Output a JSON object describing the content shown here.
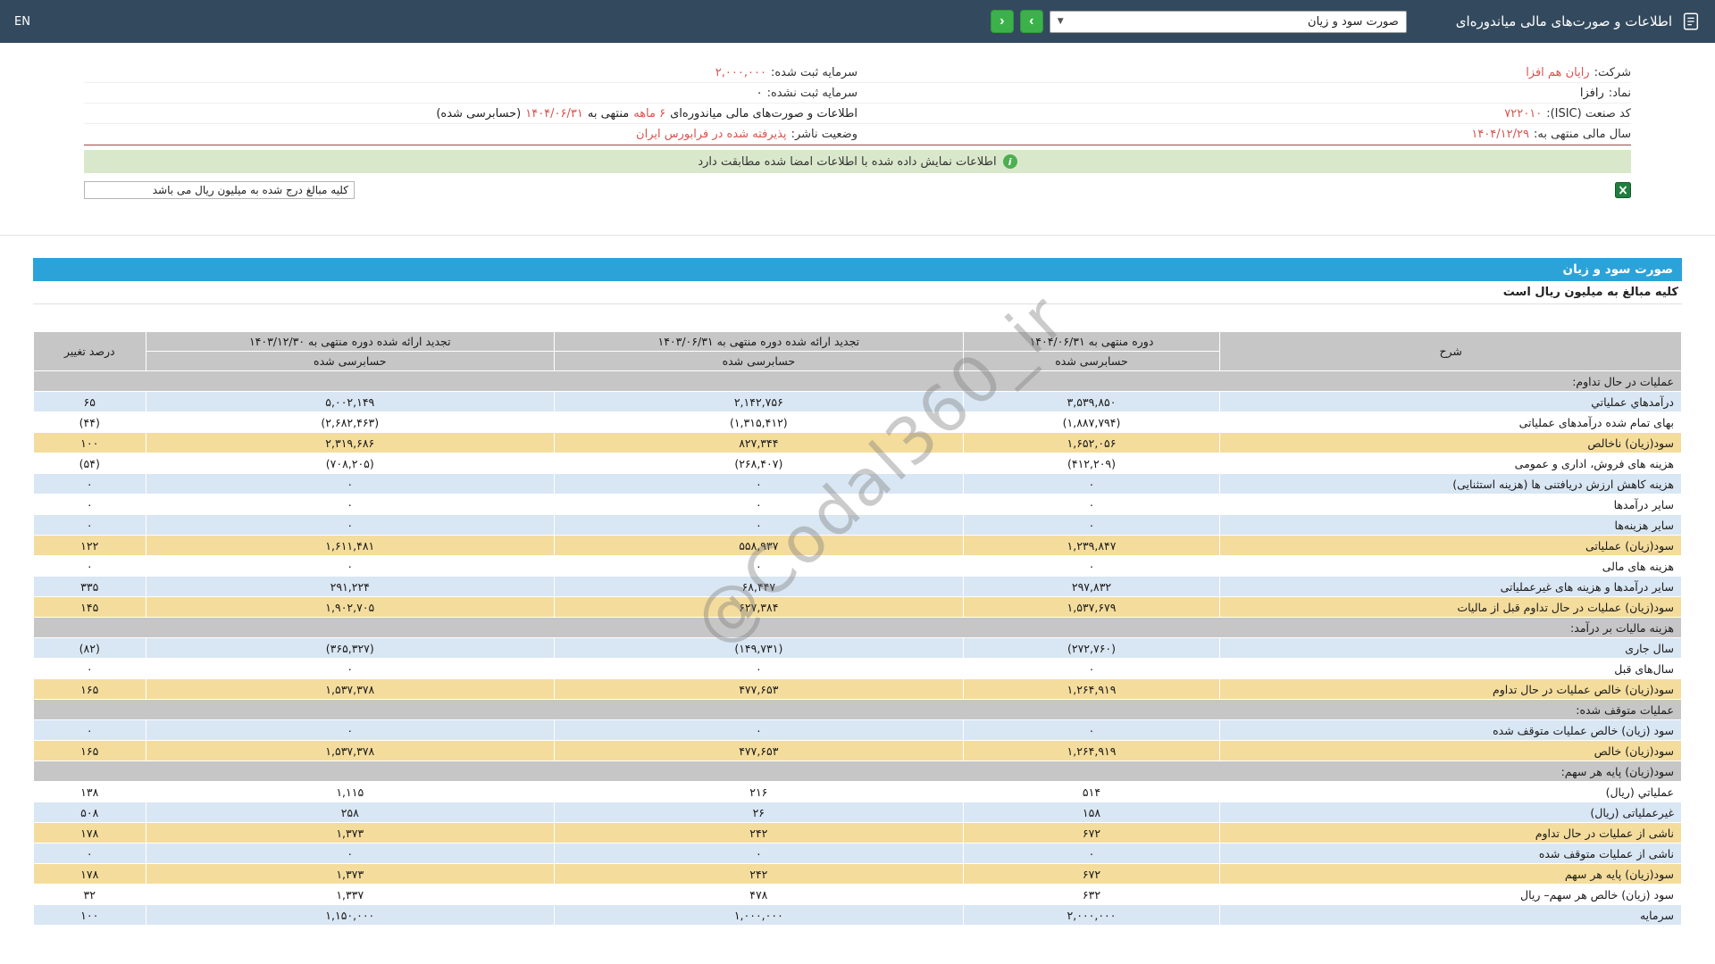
{
  "colors": {
    "navbar": "#334a5e",
    "accent_blue": "#2ba3d9",
    "row_blue": "#d9e6f3",
    "row_highlight_tan": "#f4dc9c",
    "section_gray": "#c6c6c6",
    "negative_red": "#e93323",
    "link_red": "#d9534f",
    "success_green": "#4caf50",
    "button_green": "#3cb14a"
  },
  "navbar": {
    "title": "اطلاعات و صورت‌های مالی میاندوره‌ای",
    "statement_select_value": "صورت سود و زیان",
    "btn_next": "›",
    "btn_prev": "‹",
    "language": "EN"
  },
  "company": {
    "right": [
      {
        "label": "شرکت:",
        "value": "رایان هم افزا"
      },
      {
        "label": "نماد:",
        "value": "رافزا"
      },
      {
        "label": "کد صنعت (ISIC):",
        "value": "۷۲۲۰۱۰"
      },
      {
        "label": "سال مالی منتهی به:",
        "value": "۱۴۰۴/۱۲/۲۹"
      }
    ],
    "left": [
      {
        "label": "سرمایه ثبت شده:",
        "value": "۲,۰۰۰,۰۰۰"
      },
      {
        "label": "سرمایه ثبت نشده:",
        "value": "۰"
      },
      {
        "label": "وضعیت ناشر:",
        "value": "پذیرفته شده در فرابورس ایران"
      }
    ],
    "period": {
      "p1": "اطلاعات و صورت‌های مالی میاندوره‌ای",
      "p2": "۶ ماهه",
      "p3": "منتهی به",
      "p4": "۱۴۰۴/۰۶/۳۱",
      "p5": "(حسابرسی شده)"
    }
  },
  "alert": {
    "icon_glyph": "i",
    "message": "اطلاعات نمایش داده شده با اطلاعات امضا شده مطابقت دارد"
  },
  "units_note_top": "کلیه مبالغ درج شده به میلیون ریال می باشد",
  "statement": {
    "title": "صورت سود و زیان",
    "units_note": "کلیه مبالغ به میلیون ریال است",
    "watermark": "@Codal360_ir"
  },
  "table": {
    "headers": {
      "desc": "شرح",
      "col1": "دوره منتهی به ۱۴۰۴/۰۶/۳۱",
      "col2": "تجدید ارائه شده دوره منتهی به ۱۴۰۳/۰۶/۳۱",
      "col3": "تجدید ارائه شده دوره منتهی به ۱۴۰۳/۱۲/۳۰",
      "pct": "درصد تغییر",
      "audited": "حسابرسی شده"
    },
    "rows": [
      {
        "type": "section",
        "label": "عملیات در حال تداوم:"
      },
      {
        "type": "data",
        "bg": "blue",
        "label": "درآمدهاي عملياتي",
        "v1": "۳,۵۳۹,۸۵۰",
        "v2": "۲,۱۴۲,۷۵۶",
        "v3": "۵,۰۰۲,۱۴۹",
        "pct": "۶۵"
      },
      {
        "type": "data",
        "bg": "white",
        "label": "بهای تمام شده درآمدهای عملیاتی",
        "v1": "(۱,۸۸۷,۷۹۴)",
        "v2": "(۱,۳۱۵,۴۱۲)",
        "v3": "(۲,۶۸۲,۴۶۳)",
        "pct": "(۴۴)"
      },
      {
        "type": "data",
        "bg": "tan",
        "label": "سود(زیان) ناخالص",
        "v1": "۱,۶۵۲,۰۵۶",
        "v2": "۸۲۷,۳۴۴",
        "v3": "۲,۳۱۹,۶۸۶",
        "pct": "۱۰۰"
      },
      {
        "type": "data",
        "bg": "white",
        "label": "هزینه های فروش، اداری و عمومی",
        "v1": "(۴۱۲,۲۰۹)",
        "v2": "(۲۶۸,۴۰۷)",
        "v3": "(۷۰۸,۲۰۵)",
        "pct": "(۵۴)"
      },
      {
        "type": "data",
        "bg": "blue",
        "label": "هزینه کاهش ارزش دریافتنی ها (هزینه استثنایی)",
        "v1": "۰",
        "v2": "۰",
        "v3": "۰",
        "pct": "۰"
      },
      {
        "type": "data",
        "bg": "white",
        "label": "سایر درآمدها",
        "v1": "۰",
        "v2": "۰",
        "v3": "۰",
        "pct": "۰"
      },
      {
        "type": "data",
        "bg": "blue",
        "label": "سایر هزینه‌ها",
        "v1": "۰",
        "v2": "۰",
        "v3": "۰",
        "pct": "۰"
      },
      {
        "type": "data",
        "bg": "tan",
        "label": "سود(زیان) عملیاتی",
        "v1": "۱,۲۳۹,۸۴۷",
        "v2": "۵۵۸,۹۳۷",
        "v3": "۱,۶۱۱,۴۸۱",
        "pct": "۱۲۲"
      },
      {
        "type": "data",
        "bg": "white",
        "label": "هزینه های مالی",
        "v1": "۰",
        "v2": "۰",
        "v3": "۰",
        "pct": "۰"
      },
      {
        "type": "data",
        "bg": "blue",
        "label": "سایر درآمدها و هزینه های غیرعملیاتی",
        "v1": "۲۹۷,۸۳۲",
        "v2": "۶۸,۴۴۷",
        "v3": "۲۹۱,۲۲۴",
        "pct": "۳۳۵"
      },
      {
        "type": "data",
        "bg": "tan",
        "label": "سود(زیان) عملیات در حال تداوم قبل از مالیات",
        "v1": "۱,۵۳۷,۶۷۹",
        "v2": "۶۲۷,۳۸۴",
        "v3": "۱,۹۰۲,۷۰۵",
        "pct": "۱۴۵"
      },
      {
        "type": "section",
        "label": "هزینه مالیات بر درآمد:"
      },
      {
        "type": "data",
        "bg": "blue",
        "label": "سال جاری",
        "v1": "(۲۷۲,۷۶۰)",
        "v2": "(۱۴۹,۷۳۱)",
        "v3": "(۳۶۵,۳۲۷)",
        "pct": "(۸۲)"
      },
      {
        "type": "data",
        "bg": "white",
        "label": "سال‌های قبل",
        "v1": "۰",
        "v2": "۰",
        "v3": "۰",
        "pct": "۰"
      },
      {
        "type": "data",
        "bg": "tan",
        "label": "سود(زیان) خالص عملیات در حال تداوم",
        "v1": "۱,۲۶۴,۹۱۹",
        "v2": "۴۷۷,۶۵۳",
        "v3": "۱,۵۳۷,۳۷۸",
        "pct": "۱۶۵"
      },
      {
        "type": "section",
        "label": "عملیات متوقف شده:"
      },
      {
        "type": "data",
        "bg": "blue",
        "label": "سود (زیان) خالص عملیات متوقف شده",
        "v1": "۰",
        "v2": "۰",
        "v3": "۰",
        "pct": "۰"
      },
      {
        "type": "data",
        "bg": "tan",
        "label": "سود(زیان) خالص",
        "v1": "۱,۲۶۴,۹۱۹",
        "v2": "۴۷۷,۶۵۳",
        "v3": "۱,۵۳۷,۳۷۸",
        "pct": "۱۶۵"
      },
      {
        "type": "section",
        "label": "سود(زیان) پایه هر سهم:"
      },
      {
        "type": "data",
        "bg": "white",
        "label": "عملياتي (ریال)",
        "v1": "۵۱۴",
        "v2": "۲۱۶",
        "v3": "۱,۱۱۵",
        "pct": "۱۳۸"
      },
      {
        "type": "data",
        "bg": "blue",
        "label": "غیرعملیاتی (ریال)",
        "v1": "۱۵۸",
        "v2": "۲۶",
        "v3": "۲۵۸",
        "pct": "۵۰۸"
      },
      {
        "type": "data",
        "bg": "tan",
        "label": "ناشی از عملیات در حال تداوم",
        "v1": "۶۷۲",
        "v2": "۲۴۲",
        "v3": "۱,۳۷۳",
        "pct": "۱۷۸"
      },
      {
        "type": "data",
        "bg": "blue",
        "label": "ناشی از عملیات متوقف شده",
        "v1": "۰",
        "v2": "۰",
        "v3": "۰",
        "pct": "۰"
      },
      {
        "type": "data",
        "bg": "tan",
        "label": "سود(زیان) پایه هر سهم",
        "v1": "۶۷۲",
        "v2": "۲۴۲",
        "v3": "۱,۳۷۳",
        "pct": "۱۷۸"
      },
      {
        "type": "data",
        "bg": "white",
        "label": "سود (زیان) خالص هر سهم– ریال",
        "v1": "۶۳۲",
        "v2": "۴۷۸",
        "v3": "۱,۳۳۷",
        "pct": "۳۲"
      },
      {
        "type": "data",
        "bg": "blue",
        "label": "سرمایه",
        "v1": "۲,۰۰۰,۰۰۰",
        "v2": "۱,۰۰۰,۰۰۰",
        "v3": "۱,۱۵۰,۰۰۰",
        "pct": "۱۰۰"
      }
    ]
  }
}
